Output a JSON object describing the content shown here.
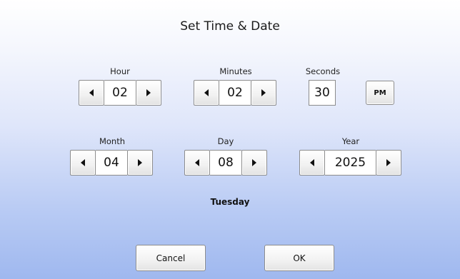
{
  "dialog": {
    "title": "Set Time & Date"
  },
  "time": {
    "hour": {
      "label": "Hour",
      "value": "02"
    },
    "minutes": {
      "label": "Minutes",
      "value": "02"
    },
    "seconds": {
      "label": "Seconds",
      "value": "30"
    },
    "ampm": "PM"
  },
  "date": {
    "month": {
      "label": "Month",
      "value": "04"
    },
    "day": {
      "label": "Day",
      "value": "08"
    },
    "year": {
      "label": "Year",
      "value": "2025"
    },
    "weekday": "Tuesday"
  },
  "actions": {
    "cancel": "Cancel",
    "ok": "OK"
  },
  "icons": {
    "decrement": "triangle-left-icon",
    "increment": "triangle-right-icon"
  }
}
